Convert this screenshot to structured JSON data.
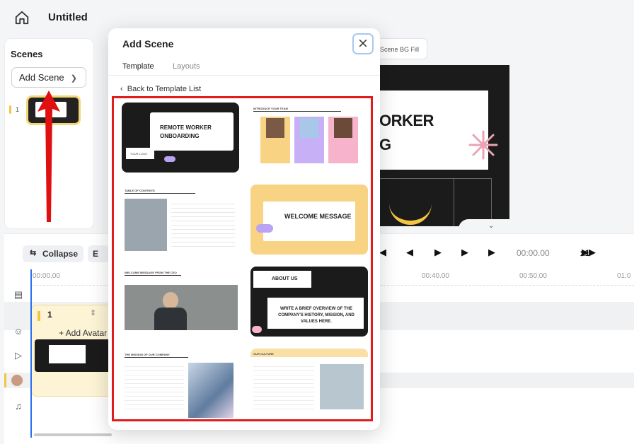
{
  "app": {
    "title": "Untitled"
  },
  "scenes_panel": {
    "title": "Scenes",
    "add_scene_label": "Add Scene",
    "scene_number": "1"
  },
  "preview": {
    "tab_label": "Scene BG Fill",
    "headline_line1": "ORKER",
    "headline_line2": "G"
  },
  "timeline": {
    "collapse_label": "Collapse",
    "expand_label": "E",
    "time_display": "00:00.00",
    "speed": "x1",
    "ruler": [
      "00:00.00",
      "00:40.00",
      "00:50.00",
      "01:0"
    ],
    "scene_track_number": "1",
    "add_avatar_label": "+ Add Avatar"
  },
  "modal": {
    "title": "Add Scene",
    "close_symbol": "×",
    "tabs": {
      "template": "Template",
      "layouts": "Layouts"
    },
    "back_label": "Back to Template List",
    "templates": {
      "t1": {
        "title_line1": "REMOTE WORKER",
        "title_line2": "ONBOARDING",
        "logo": "YOUR LOGO"
      },
      "t2": {
        "title": "INTRODUCE YOUR TEAM"
      },
      "t3": {
        "title": "TABLE OF CONTENTS"
      },
      "t4": {
        "title": "WELCOME MESSAGE"
      },
      "t5": {
        "title": "WELCOME MESSAGE FROM THE CEO"
      },
      "t6": {
        "title": "ABOUT US",
        "body": "WRITE A BRIEF OVERVIEW OF THE COMPANY'S HISTORY, MISSION, AND VALUES HERE."
      },
      "t7": {
        "title": "THE MISSION OF OUR COMPANY"
      },
      "t8": {
        "title": "OUR CULTURE"
      }
    }
  },
  "colors": {
    "accent_yellow": "#f5c542",
    "highlight_red": "#e21b1b",
    "playhead_blue": "#2b6ff2"
  },
  "icons": [
    "home-icon",
    "chevron-right-icon",
    "chevron-left-icon",
    "close-icon",
    "collapse-icon",
    "skip-back-icon",
    "step-back-icon",
    "play-icon",
    "step-forward-icon",
    "skip-forward-icon",
    "fast-forward-icon",
    "subtitle-icon",
    "avatar-icon",
    "video-icon",
    "music-icon",
    "arrow-up-icon"
  ]
}
